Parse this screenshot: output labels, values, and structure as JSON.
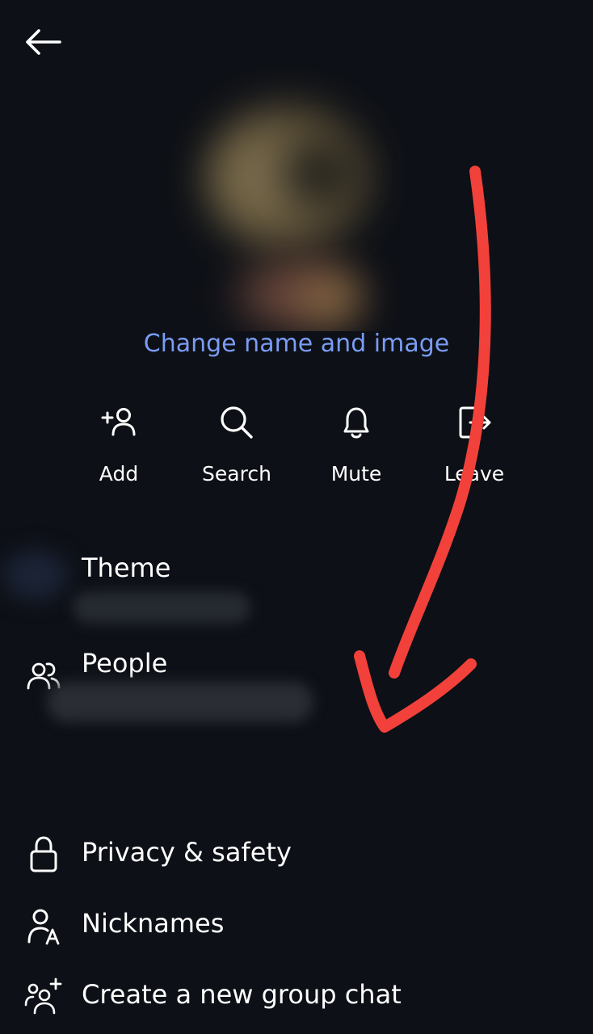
{
  "header": {
    "back_icon": "arrow-left-icon"
  },
  "group": {
    "change_link_label": "Change name and image"
  },
  "actions": [
    {
      "label": "Add",
      "icon": "add-person-icon"
    },
    {
      "label": "Search",
      "icon": "search-icon"
    },
    {
      "label": "Mute",
      "icon": "bell-icon"
    },
    {
      "label": "Leave",
      "icon": "leave-icon"
    }
  ],
  "settings": {
    "theme_label": "Theme",
    "people_label": "People",
    "privacy_label": "Privacy & safety",
    "nicknames_label": "Nicknames",
    "new_group_label": "Create a new group chat"
  },
  "colors": {
    "background": "#0d1016",
    "link": "#7a9cf5",
    "text": "#ffffff",
    "annotation": "#f2413a"
  }
}
